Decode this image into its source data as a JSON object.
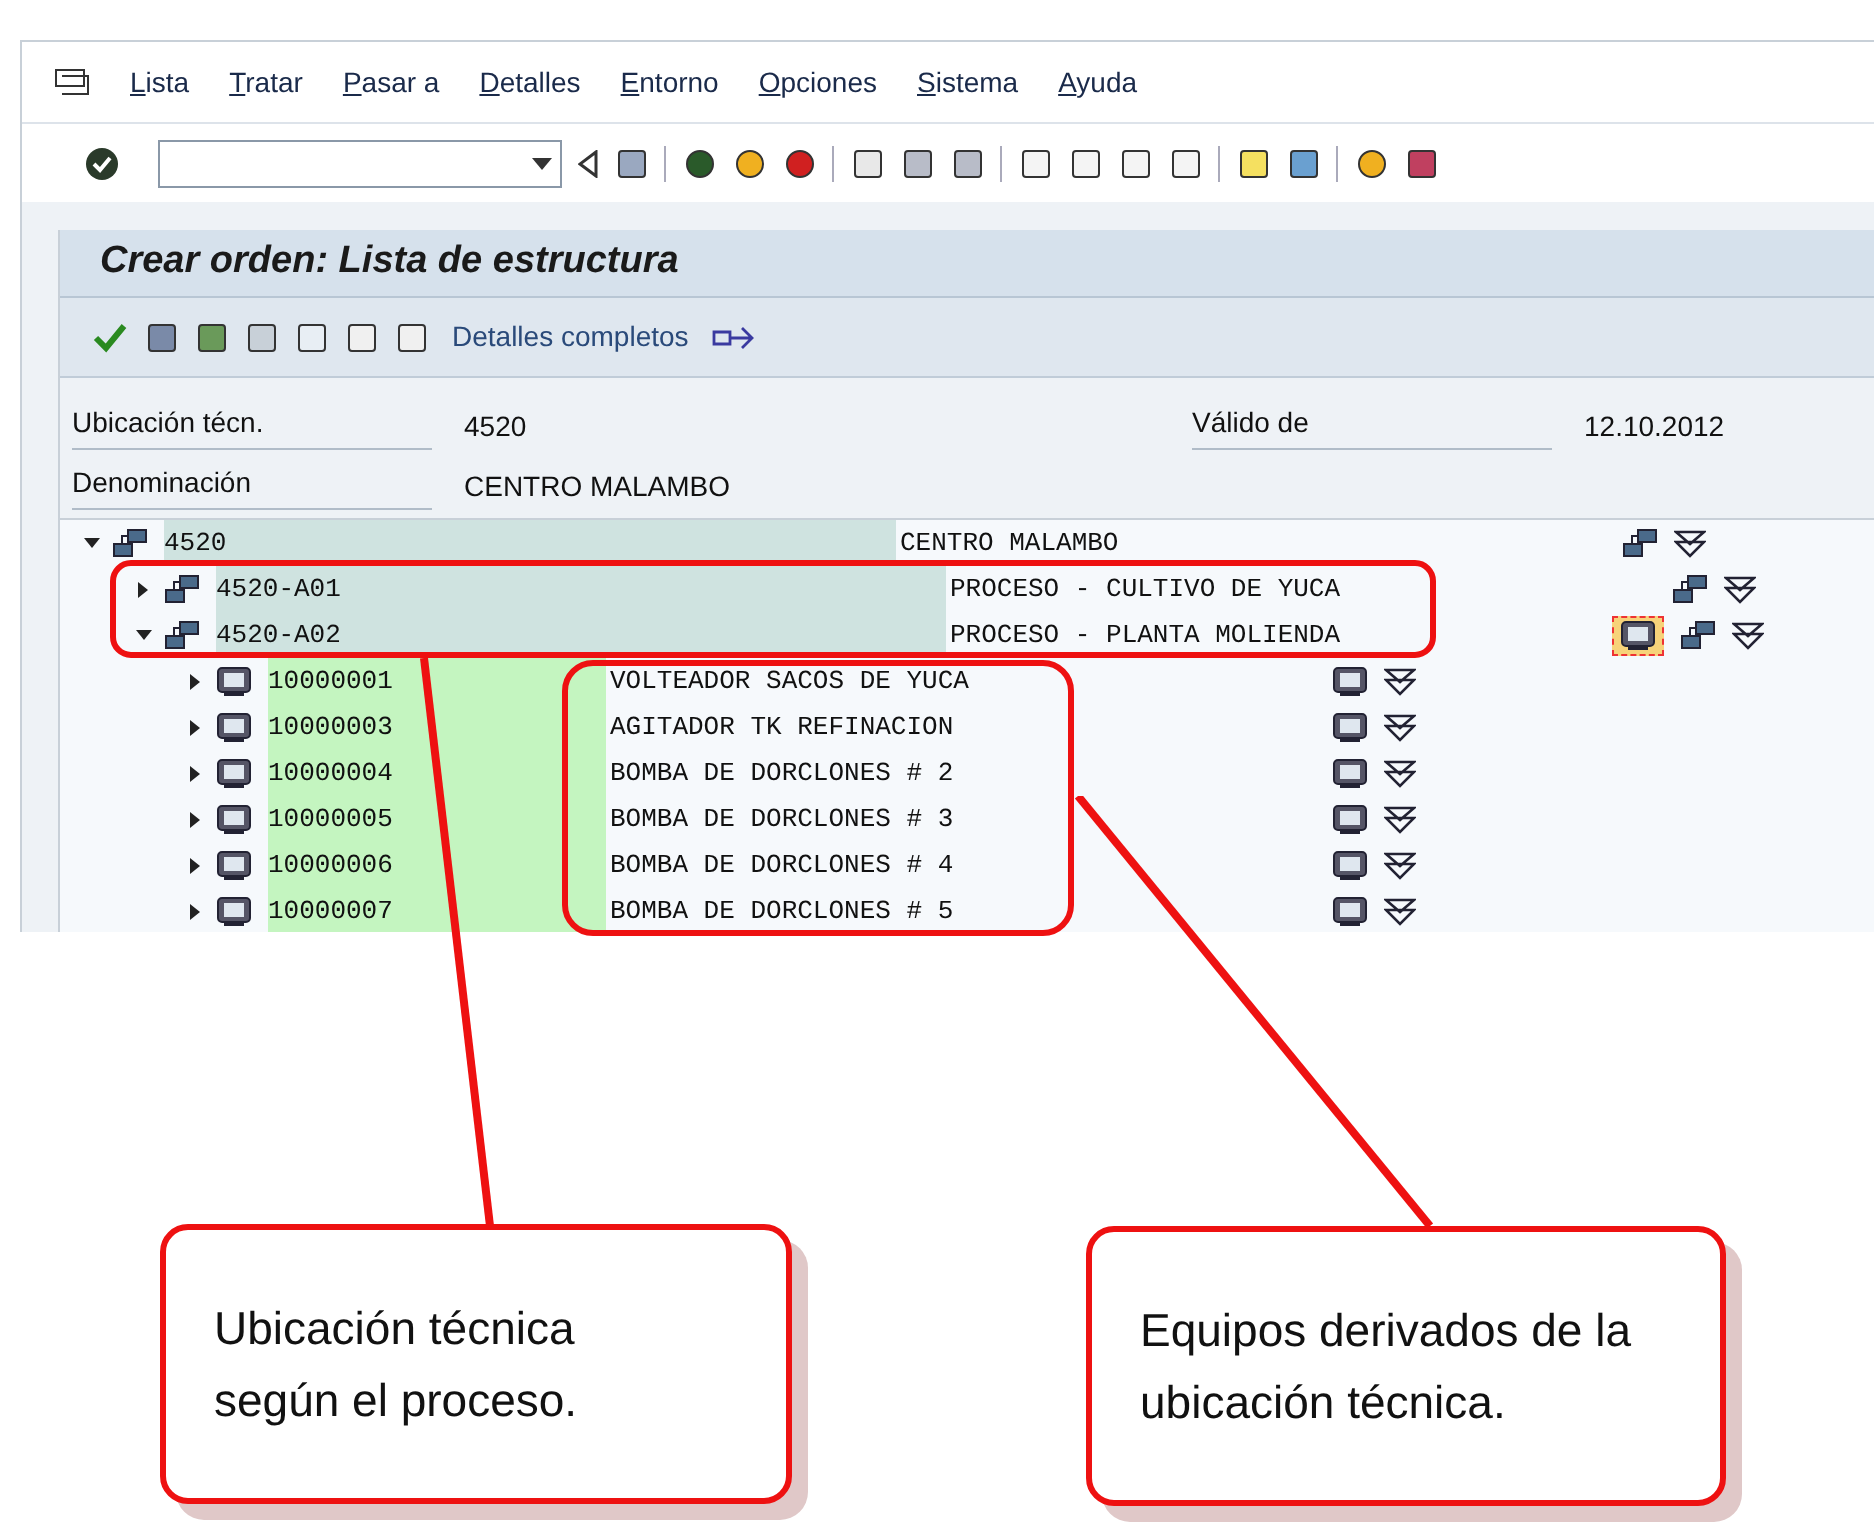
{
  "menu": [
    "Lista",
    "Tratar",
    "Pasar a",
    "Detalles",
    "Entorno",
    "Opciones",
    "Sistema",
    "Ayuda"
  ],
  "title": "Crear orden: Lista de estructura",
  "app_toolbar": {
    "button": "Detalles completos"
  },
  "fields": [
    {
      "label": "Ubicación técn.",
      "value": "4520"
    },
    {
      "label": "Válido de",
      "value": "12.10.2012"
    },
    {
      "label": "Denominación",
      "value": "CENTRO MALAMBO"
    }
  ],
  "tree": [
    {
      "kind": "location",
      "id": "4520",
      "text": "CENTRO MALAMBO",
      "expanded": true,
      "focused": false,
      "children": [
        {
          "kind": "location",
          "id": "4520-A01",
          "text": "PROCESO - CULTIVO DE YUCA",
          "expanded": false,
          "focused": false
        },
        {
          "kind": "location",
          "id": "4520-A02",
          "text": "PROCESO - PLANTA MOLIENDA",
          "expanded": true,
          "focused": true,
          "children": [
            {
              "kind": "equipment",
              "id": "10000001",
              "text": "VOLTEADOR SACOS DE YUCA",
              "expanded": false,
              "focused": false
            },
            {
              "kind": "equipment",
              "id": "10000003",
              "text": "AGITADOR TK REFINACION",
              "expanded": false,
              "focused": false
            },
            {
              "kind": "equipment",
              "id": "10000004",
              "text": "BOMBA DE DORCLONES # 2",
              "expanded": false,
              "focused": false
            },
            {
              "kind": "equipment",
              "id": "10000005",
              "text": "BOMBA DE DORCLONES # 3",
              "expanded": false,
              "focused": false
            },
            {
              "kind": "equipment",
              "id": "10000006",
              "text": "BOMBA DE DORCLONES # 4",
              "expanded": false,
              "focused": false
            },
            {
              "kind": "equipment",
              "id": "10000007",
              "text": "BOMBA DE DORCLONES # 5",
              "expanded": false,
              "focused": false
            }
          ]
        }
      ]
    }
  ],
  "callouts": [
    "Ubicación técnica según el proceso.",
    "Equipos derivados de la ubicación técnica."
  ]
}
